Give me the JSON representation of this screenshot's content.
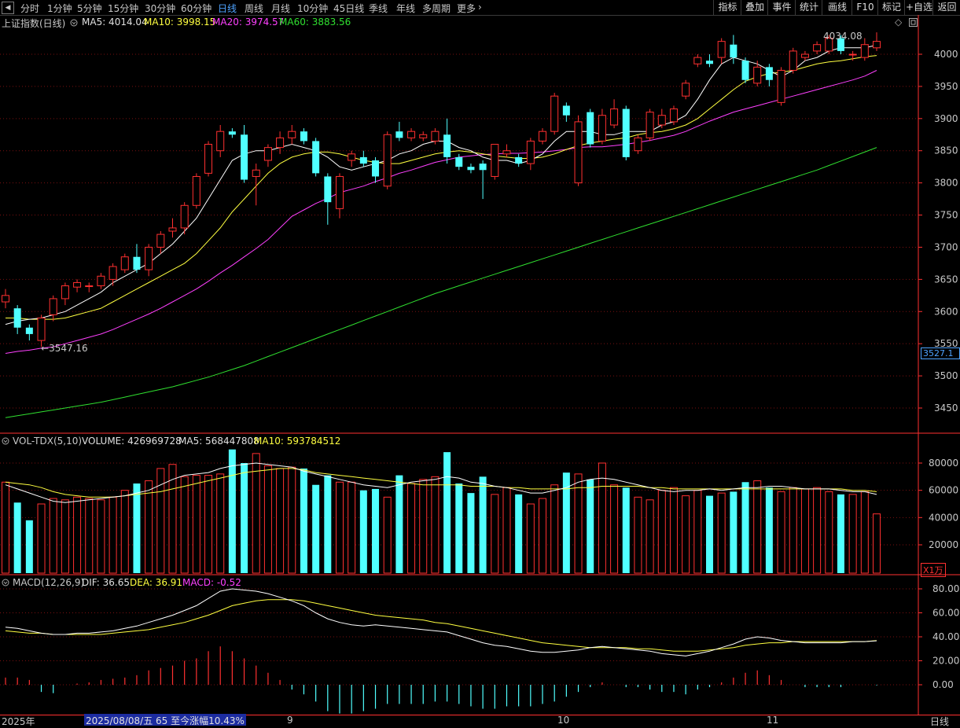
{
  "topbar": {
    "periods": [
      "分时",
      "1分钟",
      "5分钟",
      "15分钟",
      "30分钟",
      "60分钟",
      "日线",
      "周线",
      "月线",
      "10分钟",
      "45日线",
      "季线",
      "年线",
      "多周期",
      "更多"
    ],
    "active_period": "日线",
    "right_buttons": [
      "指标",
      "叠加",
      "事件",
      "统计",
      "画线",
      "F10",
      "标记",
      "+自选",
      "返回"
    ]
  },
  "main_panel": {
    "title": "上证指数(日线)",
    "ma5": "MA5: 4014.04",
    "ma10": "MA10: 3998.15",
    "ma20": "MA20: 3974.57",
    "ma60": "MA60: 3883.56",
    "low_label": "3547.16",
    "high_label": "4034.08",
    "current_price": "3527.1",
    "price_ticks": [
      "4000",
      "3950",
      "3900",
      "3850",
      "3800",
      "3750",
      "3700",
      "3650",
      "3600",
      "3550",
      "3500",
      "3450"
    ]
  },
  "vol_panel": {
    "title": "VOL-TDX(5,10)",
    "volume": "VOLUME: 426969728",
    "ma5": "MA5: 568447808",
    "ma10": "MA10: 593784512",
    "ticks": [
      "80000",
      "60000",
      "40000",
      "20000"
    ],
    "unit": "X1万"
  },
  "macd_panel": {
    "title": "MACD(12,26,9)",
    "dif": "DIF: 36.65",
    "dea": "DEA: 36.91",
    "macd": "MACD: -0.52",
    "ticks": [
      "80.00",
      "60.00",
      "40.00",
      "20.00",
      "0.00"
    ]
  },
  "bottom_bar": {
    "year": "2025年",
    "info": "2025/08/08/五 65 至今涨幅10.43%",
    "months": [
      "9",
      "10",
      "11"
    ],
    "period": "日线"
  },
  "colors": {
    "up": "#ff3030",
    "down": "#50ffff",
    "ma5": "#ffffff",
    "ma10": "#ffff40",
    "ma20": "#ff40ff",
    "ma60": "#30e030"
  },
  "chart_data": {
    "type": "candlestick",
    "price_range": [
      3420,
      4060
    ],
    "candles": [
      [
        3615,
        3625,
        3605,
        3635
      ],
      [
        3605,
        3575,
        3565,
        3610
      ],
      [
        3575,
        3565,
        3555,
        3580
      ],
      [
        3555,
        3590,
        3545,
        3595
      ],
      [
        3595,
        3620,
        3585,
        3625
      ],
      [
        3620,
        3640,
        3610,
        3645
      ],
      [
        3638,
        3645,
        3630,
        3650
      ],
      [
        3640,
        3640,
        3630,
        3645
      ],
      [
        3640,
        3655,
        3635,
        3660
      ],
      [
        3650,
        3670,
        3640,
        3675
      ],
      [
        3665,
        3685,
        3660,
        3690
      ],
      [
        3685,
        3665,
        3660,
        3705
      ],
      [
        3665,
        3700,
        3655,
        3705
      ],
      [
        3700,
        3720,
        3690,
        3725
      ],
      [
        3725,
        3730,
        3715,
        3745
      ],
      [
        3730,
        3765,
        3720,
        3770
      ],
      [
        3765,
        3810,
        3760,
        3815
      ],
      [
        3815,
        3860,
        3810,
        3865
      ],
      [
        3850,
        3880,
        3840,
        3890
      ],
      [
        3880,
        3875,
        3870,
        3885
      ],
      [
        3875,
        3805,
        3800,
        3890
      ],
      [
        3810,
        3820,
        3765,
        3830
      ],
      [
        3835,
        3855,
        3825,
        3860
      ],
      [
        3855,
        3870,
        3845,
        3880
      ],
      [
        3870,
        3880,
        3860,
        3890
      ],
      [
        3880,
        3865,
        3860,
        3885
      ],
      [
        3865,
        3815,
        3810,
        3870
      ],
      [
        3810,
        3770,
        3735,
        3815
      ],
      [
        3760,
        3810,
        3745,
        3815
      ],
      [
        3835,
        3845,
        3825,
        3850
      ],
      [
        3840,
        3830,
        3825,
        3850
      ],
      [
        3835,
        3810,
        3800,
        3840
      ],
      [
        3795,
        3875,
        3790,
        3880
      ],
      [
        3880,
        3870,
        3865,
        3895
      ],
      [
        3870,
        3880,
        3865,
        3885
      ],
      [
        3870,
        3875,
        3865,
        3880
      ],
      [
        3865,
        3880,
        3860,
        3885
      ],
      [
        3875,
        3840,
        3830,
        3900
      ],
      [
        3840,
        3825,
        3820,
        3845
      ],
      [
        3825,
        3820,
        3815,
        3830
      ],
      [
        3830,
        3820,
        3775,
        3835
      ],
      [
        3810,
        3860,
        3805,
        3860
      ],
      [
        3845,
        3850,
        3840,
        3860
      ],
      [
        3840,
        3830,
        3825,
        3845
      ],
      [
        3830,
        3865,
        3820,
        3870
      ],
      [
        3865,
        3880,
        3860,
        3885
      ],
      [
        3880,
        3935,
        3875,
        3940
      ],
      [
        3920,
        3905,
        3895,
        3925
      ],
      [
        3800,
        3895,
        3795,
        3905
      ],
      [
        3910,
        3860,
        3855,
        3915
      ],
      [
        3865,
        3905,
        3860,
        3915
      ],
      [
        3890,
        3915,
        3885,
        3930
      ],
      [
        3915,
        3840,
        3835,
        3920
      ],
      [
        3850,
        3870,
        3845,
        3875
      ],
      [
        3870,
        3910,
        3865,
        3915
      ],
      [
        3890,
        3905,
        3885,
        3915
      ],
      [
        3895,
        3915,
        3890,
        3920
      ],
      [
        3935,
        3955,
        3930,
        3960
      ],
      [
        3985,
        3995,
        3980,
        4000
      ],
      [
        3990,
        3985,
        3980,
        4000
      ],
      [
        3995,
        4020,
        3985,
        4025
      ],
      [
        4015,
        3995,
        3985,
        4030
      ],
      [
        3990,
        3960,
        3955,
        3995
      ],
      [
        3955,
        3980,
        3950,
        3990
      ],
      [
        3980,
        3960,
        3950,
        3985
      ],
      [
        3925,
        3975,
        3920,
        3980
      ],
      [
        3975,
        4005,
        3970,
        4010
      ],
      [
        3995,
        4000,
        3990,
        4005
      ],
      [
        4005,
        4015,
        4000,
        4020
      ],
      [
        4005,
        4025,
        4000,
        4030
      ],
      [
        4025,
        4005,
        4000,
        4030
      ],
      [
        4000,
        4000,
        3990,
        4005
      ],
      [
        3995,
        4015,
        3990,
        4025
      ],
      [
        4010,
        4020,
        4005,
        4034
      ]
    ],
    "ma5": [
      3580,
      3585,
      3588,
      3590,
      3595,
      3600,
      3610,
      3620,
      3630,
      3645,
      3655,
      3665,
      3675,
      3690,
      3705,
      3725,
      3745,
      3775,
      3805,
      3835,
      3845,
      3850,
      3850,
      3855,
      3860,
      3855,
      3850,
      3840,
      3825,
      3820,
      3825,
      3830,
      3835,
      3845,
      3850,
      3860,
      3865,
      3865,
      3855,
      3850,
      3840,
      3835,
      3835,
      3830,
      3835,
      3845,
      3865,
      3880,
      3880,
      3880,
      3875,
      3875,
      3880,
      3880,
      3880,
      3890,
      3895,
      3905,
      3930,
      3960,
      3985,
      3995,
      3990,
      3985,
      3975,
      3965,
      3975,
      3990,
      3995,
      4005,
      4010,
      4010,
      4010,
      4014
    ],
    "ma10": [
      3590,
      3590,
      3588,
      3588,
      3588,
      3590,
      3595,
      3600,
      3605,
      3615,
      3625,
      3635,
      3645,
      3655,
      3665,
      3675,
      3690,
      3710,
      3730,
      3755,
      3775,
      3795,
      3815,
      3830,
      3840,
      3845,
      3848,
      3848,
      3845,
      3840,
      3835,
      3832,
      3830,
      3830,
      3835,
      3840,
      3845,
      3848,
      3850,
      3848,
      3845,
      3842,
      3840,
      3838,
      3838,
      3840,
      3845,
      3852,
      3858,
      3862,
      3865,
      3868,
      3870,
      3875,
      3878,
      3880,
      3884,
      3890,
      3900,
      3915,
      3930,
      3945,
      3958,
      3965,
      3970,
      3972,
      3975,
      3980,
      3985,
      3988,
      3990,
      3993,
      3996,
      3998
    ],
    "ma20": [
      3535,
      3538,
      3540,
      3543,
      3545,
      3550,
      3555,
      3560,
      3565,
      3572,
      3580,
      3588,
      3596,
      3605,
      3615,
      3625,
      3635,
      3647,
      3660,
      3672,
      3685,
      3698,
      3712,
      3730,
      3748,
      3758,
      3768,
      3776,
      3785,
      3790,
      3795,
      3802,
      3808,
      3815,
      3820,
      3826,
      3832,
      3836,
      3840,
      3842,
      3844,
      3845,
      3846,
      3846,
      3847,
      3848,
      3850,
      3852,
      3855,
      3856,
      3856,
      3858,
      3860,
      3863,
      3866,
      3870,
      3874,
      3880,
      3888,
      3896,
      3903,
      3910,
      3915,
      3920,
      3925,
      3930,
      3935,
      3940,
      3945,
      3950,
      3955,
      3960,
      3966,
      3975
    ],
    "ma60": [
      3435,
      3438,
      3441,
      3444,
      3447,
      3450,
      3453,
      3456,
      3459,
      3463,
      3467,
      3471,
      3475,
      3479,
      3483,
      3488,
      3493,
      3498,
      3504,
      3510,
      3516,
      3523,
      3530,
      3537,
      3544,
      3551,
      3558,
      3565,
      3572,
      3579,
      3586,
      3593,
      3600,
      3607,
      3614,
      3621,
      3628,
      3634,
      3640,
      3646,
      3652,
      3658,
      3664,
      3670,
      3676,
      3682,
      3688,
      3694,
      3700,
      3706,
      3712,
      3718,
      3724,
      3730,
      3736,
      3742,
      3748,
      3754,
      3760,
      3766,
      3772,
      3778,
      3784,
      3790,
      3796,
      3802,
      3808,
      3814,
      3820,
      3827,
      3834,
      3841,
      3848,
      3855
    ],
    "volume": [
      66000,
      51000,
      38000,
      50000,
      54000,
      53000,
      55000,
      54000,
      53000,
      55000,
      60000,
      65000,
      67000,
      76000,
      79000,
      70000,
      71000,
      71000,
      72000,
      90000,
      80000,
      87000,
      78000,
      76000,
      77000,
      76000,
      64000,
      71000,
      66000,
      66000,
      60000,
      61000,
      55000,
      71000,
      65000,
      68000,
      70000,
      88000,
      65000,
      58000,
      70000,
      57000,
      62000,
      57000,
      50000,
      54000,
      64000,
      73000,
      72000,
      68000,
      80000,
      64000,
      62000,
      55000,
      53000,
      60000,
      62000,
      56000,
      60000,
      56000,
      58000,
      59000,
      66000,
      67000,
      62000,
      59000,
      62000,
      61000,
      62000,
      59000,
      57000,
      57000,
      59000,
      42700
    ],
    "vol_ma5": [
      64000,
      61000,
      58000,
      55000,
      52000,
      51000,
      52000,
      53000,
      54000,
      55000,
      56000,
      58000,
      60000,
      64000,
      68000,
      71000,
      72000,
      73000,
      76000,
      78000,
      79000,
      80000,
      79000,
      78000,
      77000,
      74000,
      72000,
      70000,
      68000,
      66000,
      64000,
      63000,
      62000,
      64000,
      66000,
      67000,
      68000,
      70000,
      69000,
      66000,
      65000,
      63000,
      62000,
      60000,
      58000,
      58000,
      60000,
      62000,
      66000,
      68000,
      69000,
      68000,
      66000,
      64000,
      62000,
      60000,
      59000,
      60000,
      60000,
      61000,
      60000,
      61000,
      62000,
      62000,
      63000,
      63000,
      62000,
      61000,
      61000,
      61000,
      60000,
      59000,
      59000,
      57000
    ],
    "vol_ma10": [
      66000,
      65000,
      64000,
      62000,
      59000,
      57000,
      56000,
      55000,
      55000,
      55000,
      56000,
      57000,
      58000,
      59000,
      61000,
      63000,
      65000,
      67000,
      69000,
      71000,
      73000,
      74000,
      75000,
      76000,
      76000,
      75000,
      73000,
      72000,
      71000,
      70000,
      69000,
      68000,
      67000,
      66000,
      65000,
      64000,
      64000,
      64000,
      64000,
      63000,
      63000,
      63000,
      62000,
      62000,
      61000,
      61000,
      61000,
      61000,
      62000,
      62000,
      63000,
      63000,
      63000,
      63000,
      62000,
      62000,
      61000,
      61000,
      61000,
      61000,
      61000,
      61000,
      61000,
      61000,
      61000,
      61000,
      61000,
      61000,
      61000,
      61000,
      61000,
      60000,
      60000,
      59000
    ],
    "dif": [
      48,
      47,
      45,
      43,
      42,
      42,
      43,
      43,
      44,
      45,
      47,
      49,
      52,
      55,
      58,
      62,
      66,
      72,
      78,
      80,
      79,
      78,
      76,
      73,
      70,
      66,
      60,
      55,
      52,
      50,
      49,
      50,
      49,
      48,
      47,
      46,
      45,
      44,
      41,
      38,
      35,
      33,
      32,
      30,
      28,
      27,
      27,
      28,
      29,
      31,
      32,
      31,
      30,
      29,
      28,
      26,
      25,
      24,
      26,
      28,
      31,
      34,
      38,
      40,
      39,
      37,
      36,
      35,
      35,
      35,
      35,
      36,
      36,
      36.65
    ],
    "dea": [
      45,
      44,
      43,
      43,
      42,
      42,
      42,
      42,
      42,
      43,
      44,
      45,
      46,
      48,
      50,
      52,
      55,
      58,
      62,
      66,
      68,
      70,
      71,
      71,
      71,
      70,
      68,
      66,
      64,
      62,
      60,
      58,
      57,
      56,
      55,
      54,
      52,
      51,
      49,
      47,
      45,
      43,
      41,
      39,
      37,
      35,
      34,
      33,
      32,
      31,
      31,
      31,
      31,
      30,
      30,
      29,
      28,
      28,
      28,
      29,
      30,
      31,
      33,
      34,
      35,
      35,
      36,
      36,
      36,
      36,
      36,
      36,
      36,
      36.91
    ],
    "macd": [
      6,
      6,
      4,
      -6,
      -7,
      0,
      1,
      2,
      4,
      5,
      6,
      8,
      12,
      14,
      16,
      20,
      22,
      28,
      32,
      28,
      22,
      16,
      10,
      4,
      -4,
      -8,
      -14,
      -22,
      -24,
      -24,
      -22,
      -20,
      -16,
      -16,
      -16,
      -16,
      -14,
      -14,
      -16,
      -18,
      -20,
      -20,
      -18,
      -18,
      -18,
      -16,
      -14,
      -10,
      -6,
      -2,
      2,
      0,
      -2,
      -2,
      -4,
      -6,
      -6,
      -8,
      -4,
      -2,
      2,
      6,
      10,
      12,
      8,
      4,
      0,
      -2,
      -2,
      -2,
      -2,
      0,
      0,
      -0.52
    ]
  }
}
